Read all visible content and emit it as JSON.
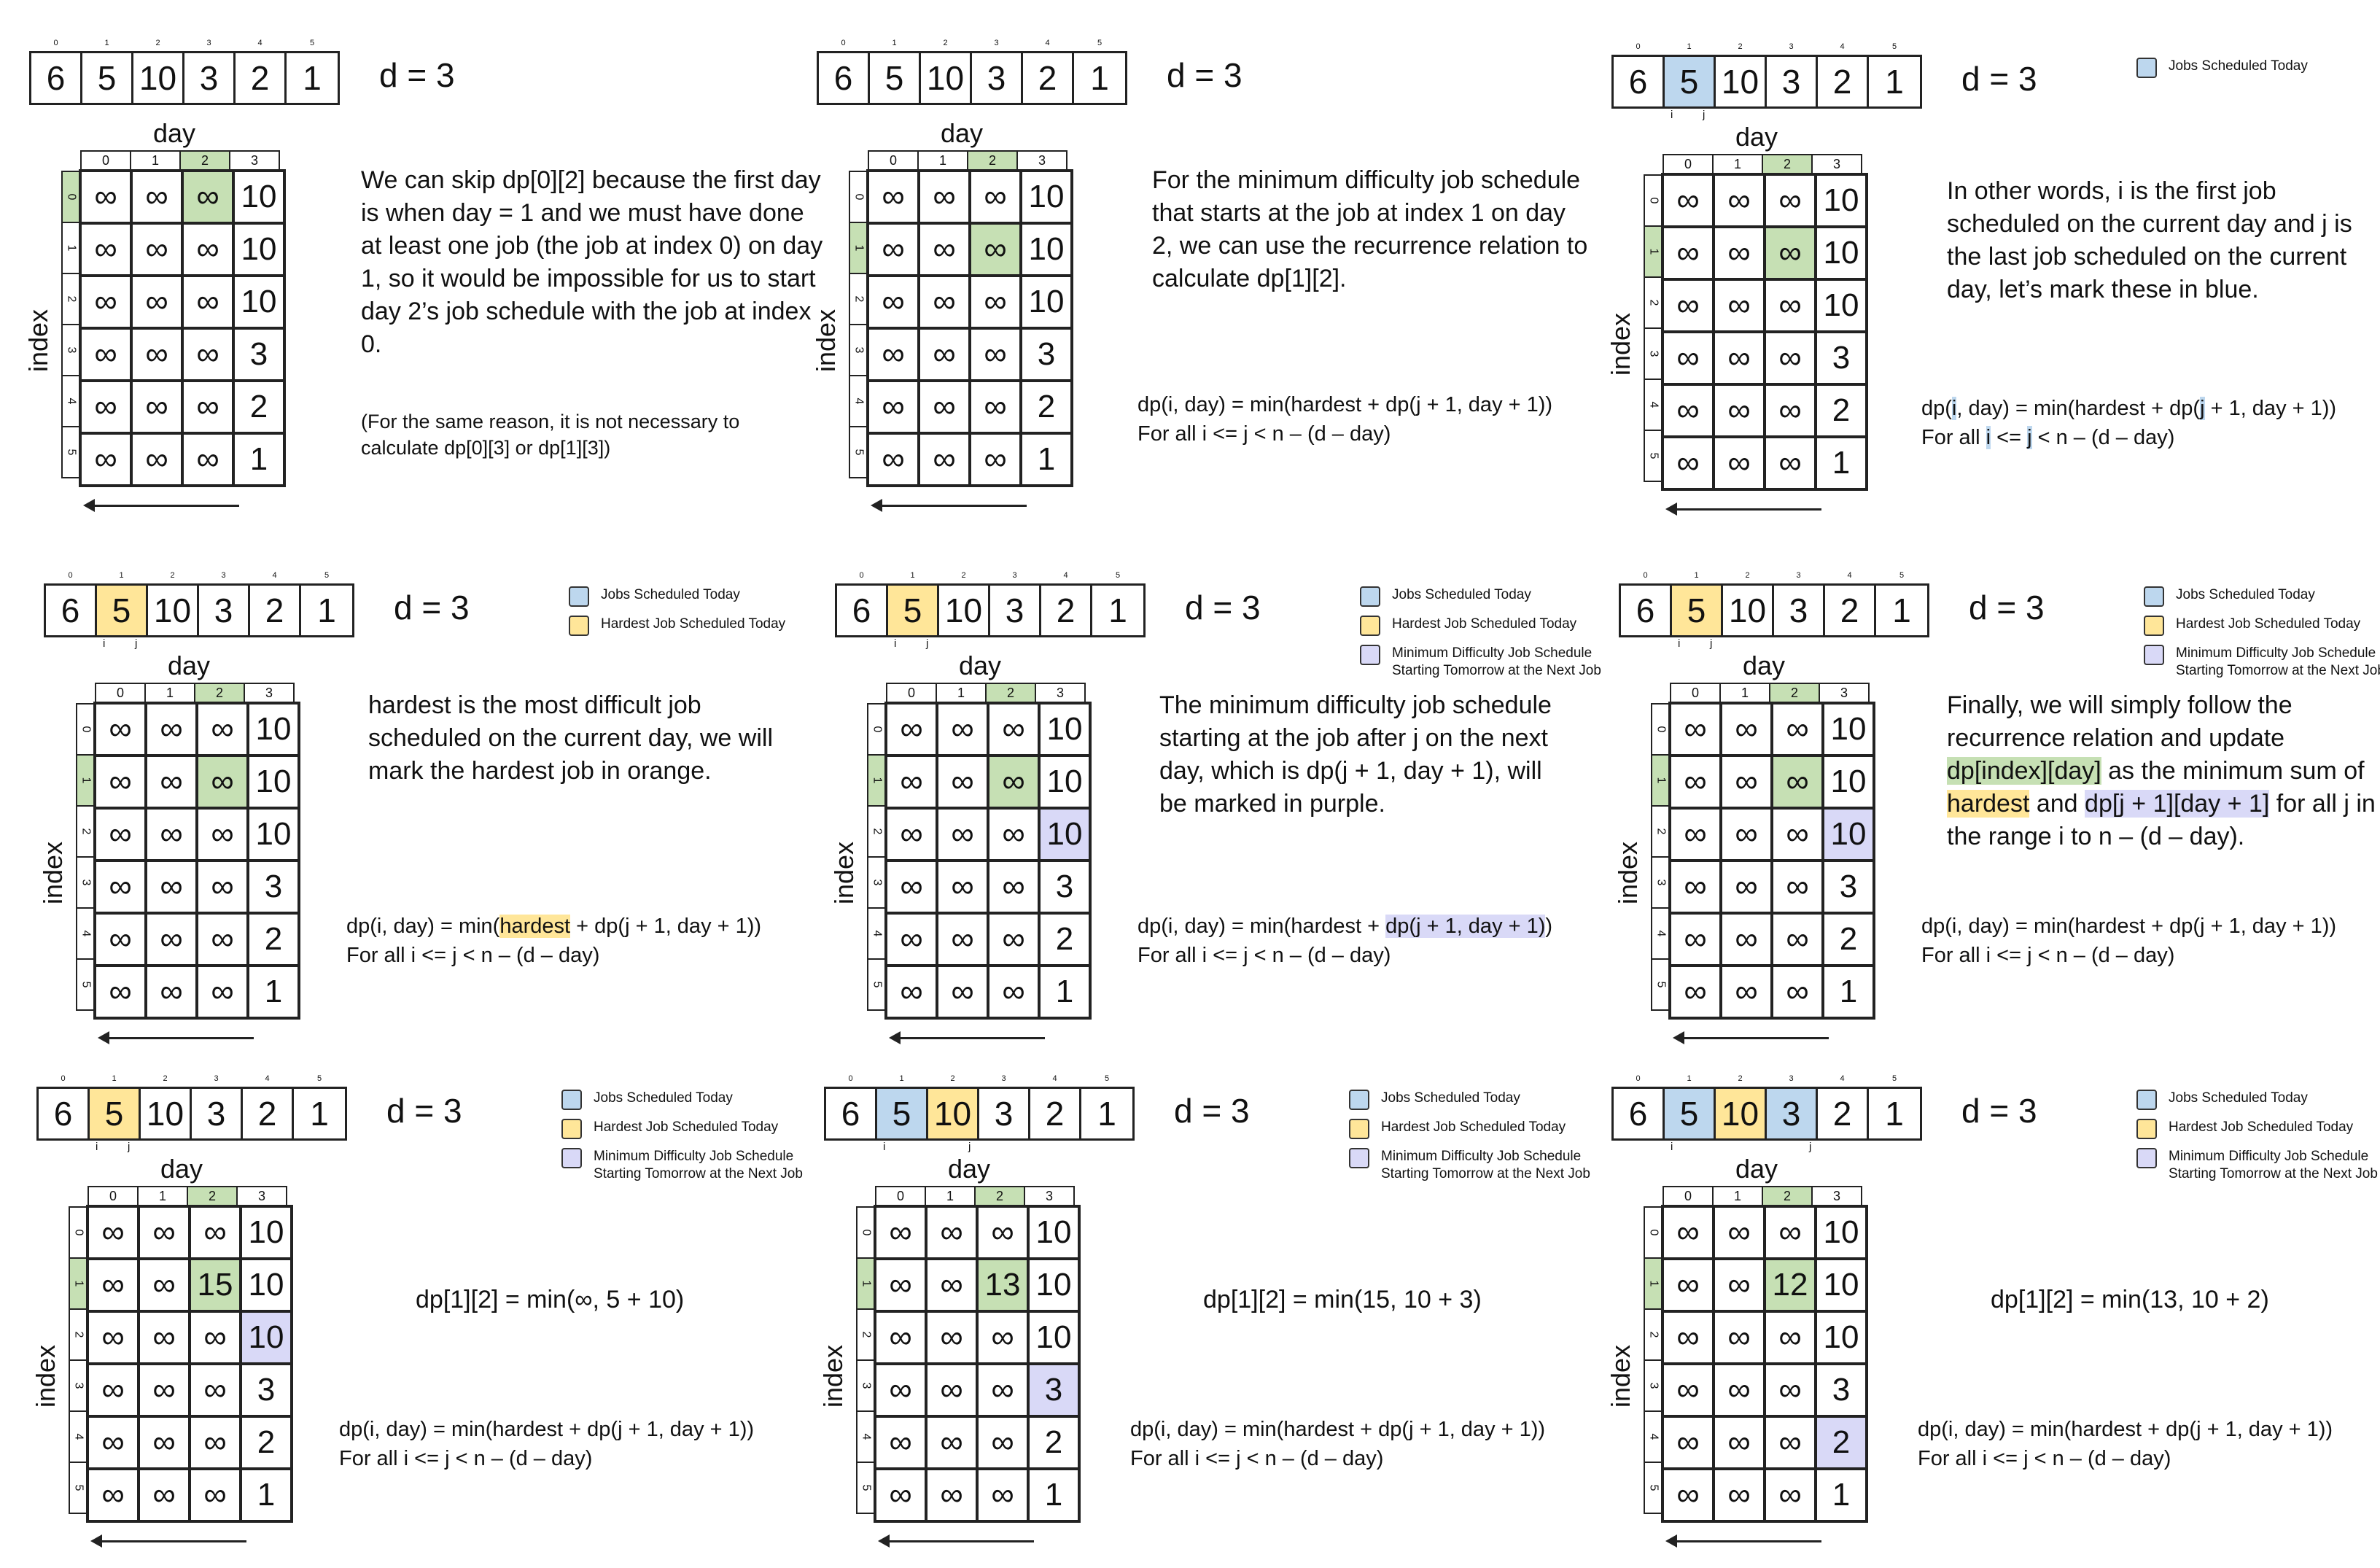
{
  "array": {
    "values": [
      "6",
      "5",
      "10",
      "3",
      "2",
      "1"
    ],
    "indices": [
      "0",
      "1",
      "2",
      "3",
      "4",
      "5"
    ]
  },
  "d_label": "d = 3",
  "day_label": "day",
  "index_label": "index",
  "col_headers": [
    "0",
    "1",
    "2",
    "3"
  ],
  "row_headers": [
    "0",
    "1",
    "2",
    "3",
    "4",
    "5"
  ],
  "i_marker": "i",
  "j_marker": "j",
  "legend": {
    "jobs_today": "Jobs Scheduled Today",
    "hardest_today": "Hardest Job Scheduled Today",
    "min_tomorrow_line1": "Minimum Difficulty Job Schedule",
    "min_tomorrow_line2": "Starting Tomorrow at the Next Job"
  },
  "formula": {
    "line1_prefix": "dp(",
    "line1_i": "i",
    "line1_mid": ", day) = min(",
    "line1_hardest": "hardest",
    "line1_plus": " + ",
    "line1_dp": "dp(",
    "line1_j": "j",
    "line1_rest": " + 1, day + 1)",
    "line1_close": ")",
    "line2_prefix": "For all ",
    "line2_i": "i",
    "line2_mid": " <= ",
    "line2_j": "j",
    "line2_rest": " < n – (d – day)"
  },
  "colors": {
    "green": "#c6e0b4",
    "blue": "#bdd7ee",
    "orange": "#ffe699",
    "purple": "#d9d9f7"
  },
  "panels": [
    {
      "grid": [
        [
          "∞",
          "∞",
          "∞",
          "10"
        ],
        [
          "∞",
          "∞",
          "∞",
          "10"
        ],
        [
          "∞",
          "∞",
          "∞",
          "10"
        ],
        [
          "∞",
          "∞",
          "∞",
          "3"
        ],
        [
          "∞",
          "∞",
          "∞",
          "2"
        ],
        [
          "∞",
          "∞",
          "∞",
          "1"
        ]
      ],
      "text": "We can skip dp[0][2] because the first day is when day = 1 and we must have done at least one job (the job at index 0) on day 1, so it would be impossible for us to start day 2’s job schedule with the job at index 0.",
      "note": "(For the same reason, it is not necessary to calculate dp[0][3] or dp[1][3])"
    },
    {
      "grid": [
        [
          "∞",
          "∞",
          "∞",
          "10"
        ],
        [
          "∞",
          "∞",
          "∞",
          "10"
        ],
        [
          "∞",
          "∞",
          "∞",
          "10"
        ],
        [
          "∞",
          "∞",
          "∞",
          "3"
        ],
        [
          "∞",
          "∞",
          "∞",
          "2"
        ],
        [
          "∞",
          "∞",
          "∞",
          "1"
        ]
      ],
      "text": "For the minimum difficulty job schedule that starts at the job at index 1 on day 2, we can use the recurrence relation to calculate dp[1][2]."
    },
    {
      "grid": [
        [
          "∞",
          "∞",
          "∞",
          "10"
        ],
        [
          "∞",
          "∞",
          "∞",
          "10"
        ],
        [
          "∞",
          "∞",
          "∞",
          "10"
        ],
        [
          "∞",
          "∞",
          "∞",
          "3"
        ],
        [
          "∞",
          "∞",
          "∞",
          "2"
        ],
        [
          "∞",
          "∞",
          "∞",
          "1"
        ]
      ],
      "text": "In other words, i is the first job scheduled on the current day and j is the last job scheduled on the current day, let’s mark these in blue."
    },
    {
      "grid": [
        [
          "∞",
          "∞",
          "∞",
          "10"
        ],
        [
          "∞",
          "∞",
          "∞",
          "10"
        ],
        [
          "∞",
          "∞",
          "∞",
          "10"
        ],
        [
          "∞",
          "∞",
          "∞",
          "3"
        ],
        [
          "∞",
          "∞",
          "∞",
          "2"
        ],
        [
          "∞",
          "∞",
          "∞",
          "1"
        ]
      ],
      "text": "hardest is the most difficult job scheduled on the current day, we will mark the hardest job in orange."
    },
    {
      "grid": [
        [
          "∞",
          "∞",
          "∞",
          "10"
        ],
        [
          "∞",
          "∞",
          "∞",
          "10"
        ],
        [
          "∞",
          "∞",
          "∞",
          "10"
        ],
        [
          "∞",
          "∞",
          "∞",
          "3"
        ],
        [
          "∞",
          "∞",
          "∞",
          "2"
        ],
        [
          "∞",
          "∞",
          "∞",
          "1"
        ]
      ],
      "text": "The minimum difficulty job schedule starting at the job after j on the next day, which is dp(j + 1, day + 1), will be marked in purple."
    },
    {
      "grid": [
        [
          "∞",
          "∞",
          "∞",
          "10"
        ],
        [
          "∞",
          "∞",
          "∞",
          "10"
        ],
        [
          "∞",
          "∞",
          "∞",
          "10"
        ],
        [
          "∞",
          "∞",
          "∞",
          "3"
        ],
        [
          "∞",
          "∞",
          "∞",
          "2"
        ],
        [
          "∞",
          "∞",
          "∞",
          "1"
        ]
      ],
      "text_parts": [
        "Finally, we will simply follow the recurrence relation and update ",
        "dp[index][day]",
        " as the minimum sum of ",
        "hardest",
        " and ",
        "dp[j + 1][day + 1]",
        " for all j in the range i to n – (d – day)."
      ]
    },
    {
      "grid": [
        [
          "∞",
          "∞",
          "∞",
          "10"
        ],
        [
          "∞",
          "∞",
          "15",
          "10"
        ],
        [
          "∞",
          "∞",
          "∞",
          "10"
        ],
        [
          "∞",
          "∞",
          "∞",
          "3"
        ],
        [
          "∞",
          "∞",
          "∞",
          "2"
        ],
        [
          "∞",
          "∞",
          "∞",
          "1"
        ]
      ],
      "eq": "dp[1][2] = min(∞, 5 + 10)"
    },
    {
      "grid": [
        [
          "∞",
          "∞",
          "∞",
          "10"
        ],
        [
          "∞",
          "∞",
          "13",
          "10"
        ],
        [
          "∞",
          "∞",
          "∞",
          "10"
        ],
        [
          "∞",
          "∞",
          "∞",
          "3"
        ],
        [
          "∞",
          "∞",
          "∞",
          "2"
        ],
        [
          "∞",
          "∞",
          "∞",
          "1"
        ]
      ],
      "eq": "dp[1][2] = min(15, 10 + 3)"
    },
    {
      "grid": [
        [
          "∞",
          "∞",
          "∞",
          "10"
        ],
        [
          "∞",
          "∞",
          "12",
          "10"
        ],
        [
          "∞",
          "∞",
          "∞",
          "10"
        ],
        [
          "∞",
          "∞",
          "∞",
          "3"
        ],
        [
          "∞",
          "∞",
          "∞",
          "2"
        ],
        [
          "∞",
          "∞",
          "∞",
          "1"
        ]
      ],
      "eq": "dp[1][2] = min(13, 10 + 2)"
    }
  ]
}
